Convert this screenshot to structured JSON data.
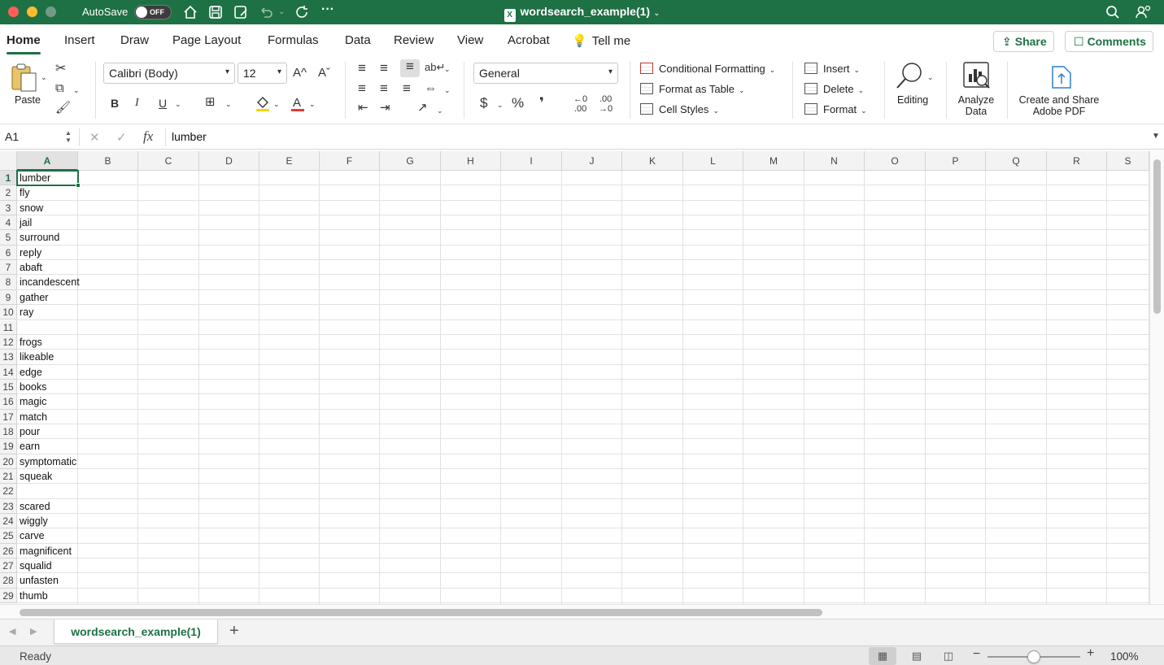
{
  "titlebar": {
    "autosave_label": "AutoSave",
    "autosave_state": "OFF",
    "document_title": "wordsearch_example(1)"
  },
  "ribbon_tabs": [
    "Home",
    "Insert",
    "Draw",
    "Page Layout",
    "Formulas",
    "Data",
    "Review",
    "View",
    "Acrobat"
  ],
  "tell_me": "Tell me",
  "share_label": "Share",
  "comments_label": "Comments",
  "ribbon": {
    "paste_label": "Paste",
    "font_name": "Calibri (Body)",
    "font_size": "12",
    "grow_font": "A^",
    "shrink_font": "Aˇ",
    "bold": "B",
    "italic": "I",
    "underline": "U",
    "number_format": "General",
    "currency": "$",
    "percent": "%",
    "comma": "❜",
    "increase_decimal": ".00",
    "decrease_decimal": ".00",
    "conditional_formatting": "Conditional Formatting",
    "format_as_table": "Format as Table",
    "cell_styles": "Cell Styles",
    "insert": "Insert",
    "delete": "Delete",
    "format": "Format",
    "editing": "Editing",
    "analyze_data_1": "Analyze",
    "analyze_data_2": "Data",
    "create_share_1": "Create and Share",
    "create_share_2": "Adobe PDF"
  },
  "formula_bar": {
    "name_box": "A1",
    "fx": "fx",
    "formula": "lumber"
  },
  "sheet": {
    "columns": [
      "A",
      "B",
      "C",
      "D",
      "E",
      "F",
      "G",
      "H",
      "I",
      "J",
      "K",
      "L",
      "M",
      "N",
      "O",
      "P",
      "Q",
      "R",
      "S"
    ],
    "selected_column": "A",
    "selected_row": 1,
    "rows": [
      {
        "n": "1",
        "a": "lumber"
      },
      {
        "n": "2",
        "a": "fly"
      },
      {
        "n": "3",
        "a": "snow"
      },
      {
        "n": "4",
        "a": "jail"
      },
      {
        "n": "5",
        "a": "surround"
      },
      {
        "n": "6",
        "a": "reply"
      },
      {
        "n": "7",
        "a": "abaft"
      },
      {
        "n": "8",
        "a": "incandescent"
      },
      {
        "n": "9",
        "a": "gather"
      },
      {
        "n": "10",
        "a": "ray"
      },
      {
        "n": "11",
        "a": ""
      },
      {
        "n": "12",
        "a": "frogs"
      },
      {
        "n": "13",
        "a": "likeable"
      },
      {
        "n": "14",
        "a": "edge"
      },
      {
        "n": "15",
        "a": "books"
      },
      {
        "n": "16",
        "a": "magic"
      },
      {
        "n": "17",
        "a": "match"
      },
      {
        "n": "18",
        "a": "pour"
      },
      {
        "n": "19",
        "a": "earn"
      },
      {
        "n": "20",
        "a": "symptomatic"
      },
      {
        "n": "21",
        "a": "squeak"
      },
      {
        "n": "22",
        "a": ""
      },
      {
        "n": "23",
        "a": "scared"
      },
      {
        "n": "24",
        "a": "wiggly"
      },
      {
        "n": "25",
        "a": "carve"
      },
      {
        "n": "26",
        "a": "magnificent"
      },
      {
        "n": "27",
        "a": "squalid"
      },
      {
        "n": "28",
        "a": "unfasten"
      },
      {
        "n": "29",
        "a": "thumb"
      }
    ]
  },
  "sheet_tab": "wordsearch_example(1)",
  "status": "Ready",
  "zoom": "100%",
  "colors": {
    "accent": "#1e7145"
  }
}
